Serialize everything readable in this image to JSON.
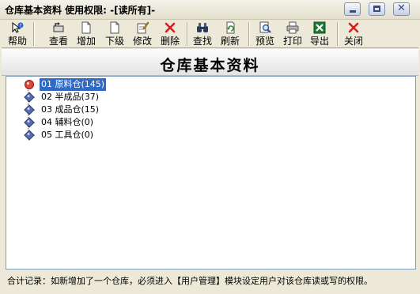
{
  "window": {
    "title": "仓库基本资料 使用权限: -[读所有]-"
  },
  "toolbar": {
    "buttons": [
      {
        "label": "帮助",
        "icon": "help-icon"
      },
      {
        "label": "查看",
        "icon": "view-icon"
      },
      {
        "label": "增加",
        "icon": "add-icon"
      },
      {
        "label": "下级",
        "icon": "sublevel-icon"
      },
      {
        "label": "修改",
        "icon": "edit-icon"
      },
      {
        "label": "删除",
        "icon": "delete-icon"
      },
      {
        "label": "查找",
        "icon": "find-icon"
      },
      {
        "label": "刷新",
        "icon": "refresh-icon"
      },
      {
        "label": "预览",
        "icon": "preview-icon"
      },
      {
        "label": "打印",
        "icon": "print-icon"
      },
      {
        "label": "导出",
        "icon": "excel-export-icon"
      },
      {
        "label": "关闭",
        "icon": "close-icon"
      }
    ]
  },
  "header": {
    "title": "仓库基本资料"
  },
  "tree": {
    "items": [
      {
        "label": "01 原料仓(145)",
        "selected": true
      },
      {
        "label": "02 半成品(37)",
        "selected": false
      },
      {
        "label": "03 成品仓(15)",
        "selected": false
      },
      {
        "label": "04 辅料仓(0)",
        "selected": false
      },
      {
        "label": "05 工具仓(0)",
        "selected": false
      }
    ]
  },
  "status": {
    "text": "合计记录：如新增加了一个仓库，必须进入【用户管理】模块设定用户对该仓库读或写的权限。"
  },
  "colors": {
    "selection": "#316ac5",
    "node_selected": "#e0463c",
    "node_default": "#5a6fb0",
    "window_bg": "#ece9d8"
  }
}
